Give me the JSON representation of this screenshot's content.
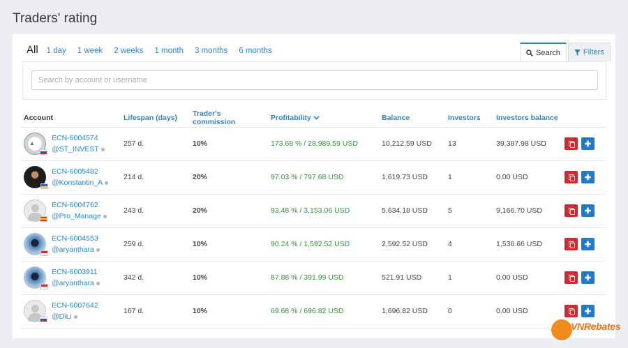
{
  "page": {
    "title": "Traders' rating"
  },
  "periods": {
    "all": "All",
    "items": [
      "1 day",
      "1 week",
      "2 weeks",
      "1 month",
      "3 months",
      "6 months"
    ]
  },
  "tabs": {
    "search": "Search",
    "filters": "Filters"
  },
  "search": {
    "placeholder": "Search by account or username"
  },
  "table": {
    "headers": {
      "account": "Account",
      "lifespan": "Lifespan (days)",
      "commission": "Trader's commission",
      "profitability": "Profitability",
      "balance": "Balance",
      "investors": "Investors",
      "investors_balance": "Investors balance"
    },
    "rows": [
      {
        "id": "ECN-6004574",
        "user": "@ST_INVEST",
        "lifespan": "257 d.",
        "commission": "10%",
        "profit": "173.68 % / 28,989.59 USD",
        "balance": "10,212.59 USD",
        "investors": "13",
        "inv_balance": "39,387.98 USD"
      },
      {
        "id": "ECN-6005482",
        "user": "@Konstantin_A",
        "lifespan": "214 d.",
        "commission": "20%",
        "profit": "97.03 % / 797.68 USD",
        "balance": "1,619.73 USD",
        "investors": "1",
        "inv_balance": "0.00 USD"
      },
      {
        "id": "ECN-6004762",
        "user": "@Pro_Manage",
        "lifespan": "243 d.",
        "commission": "20%",
        "profit": "93.48 % / 3,153.06 USD",
        "balance": "5,634.18 USD",
        "investors": "5",
        "inv_balance": "9,166.70 USD"
      },
      {
        "id": "ECN-6004553",
        "user": "@aryanthara",
        "lifespan": "259 d.",
        "commission": "10%",
        "profit": "90.24 % / 1,592.52 USD",
        "balance": "2,592.52 USD",
        "investors": "4",
        "inv_balance": "1,536.66 USD"
      },
      {
        "id": "ECN-6003911",
        "user": "@aryanthara",
        "lifespan": "342 d.",
        "commission": "10%",
        "profit": "87.88 % / 391.99 USD",
        "balance": "521.91 USD",
        "investors": "1",
        "inv_balance": "0.00 USD"
      },
      {
        "id": "ECN-6007642",
        "user": "@DiLi",
        "lifespan": "167 d.",
        "commission": "10%",
        "profit": "69.68 % / 696.82 USD",
        "balance": "1,696.82 USD",
        "investors": "0",
        "inv_balance": "0.00 USD"
      }
    ]
  },
  "watermark": {
    "brand": "VNRebates"
  },
  "colors": {
    "link": "#2a86c4",
    "profit": "#3b8a42",
    "copy_button": "#d7262e",
    "add_button": "#1f7bc9"
  },
  "icons": {
    "search": "search-icon",
    "filters": "filter-icon",
    "sort": "chevron-down-icon",
    "copy": "copy-icon",
    "add": "plus-icon"
  }
}
